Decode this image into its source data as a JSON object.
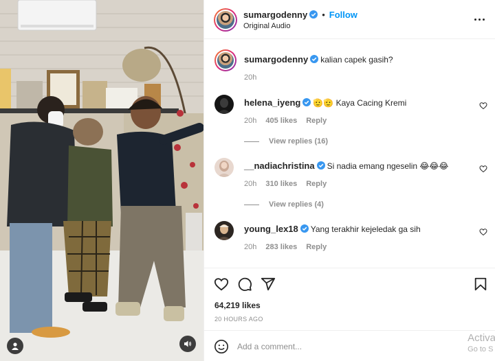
{
  "post": {
    "username": "sumargodenny",
    "follow_label": "Follow",
    "dot": "•",
    "audio_label": "Original Audio",
    "caption_user": "sumargodenny",
    "caption_text": "kalian capek gasih?",
    "caption_age": "20h"
  },
  "comments": [
    {
      "user": "helena_iyeng",
      "text": "🫡🫡 Kaya Cacing Kremi",
      "age": "20h",
      "likes": "405 likes",
      "reply": "Reply",
      "view_replies": "View replies (16)"
    },
    {
      "user": "__nadiachristina",
      "text": "Si nadia emang ngeselin 😂😂😂",
      "age": "20h",
      "likes": "310 likes",
      "reply": "Reply",
      "view_replies": "View replies (4)"
    },
    {
      "user": "young_lex18",
      "text": "Yang terakhir kejeledak ga sih",
      "age": "20h",
      "likes": "283 likes",
      "reply": "Reply"
    }
  ],
  "stats": {
    "likes": "64,219 likes",
    "posted": "20 HOURS AGO"
  },
  "add_comment": {
    "placeholder": "Add a comment..."
  },
  "watermark": {
    "line1": "Activa",
    "line2": "Go to S"
  },
  "colors": {
    "accent": "#0095f6",
    "verified": "#3897f0",
    "muted": "#8e8e8e",
    "text": "#262626"
  },
  "icons": [
    "verified-badge-icon",
    "more-options-icon",
    "heart-icon",
    "comment-icon",
    "share-icon",
    "bookmark-icon",
    "emoji-icon",
    "user-tag-icon",
    "sound-icon"
  ]
}
